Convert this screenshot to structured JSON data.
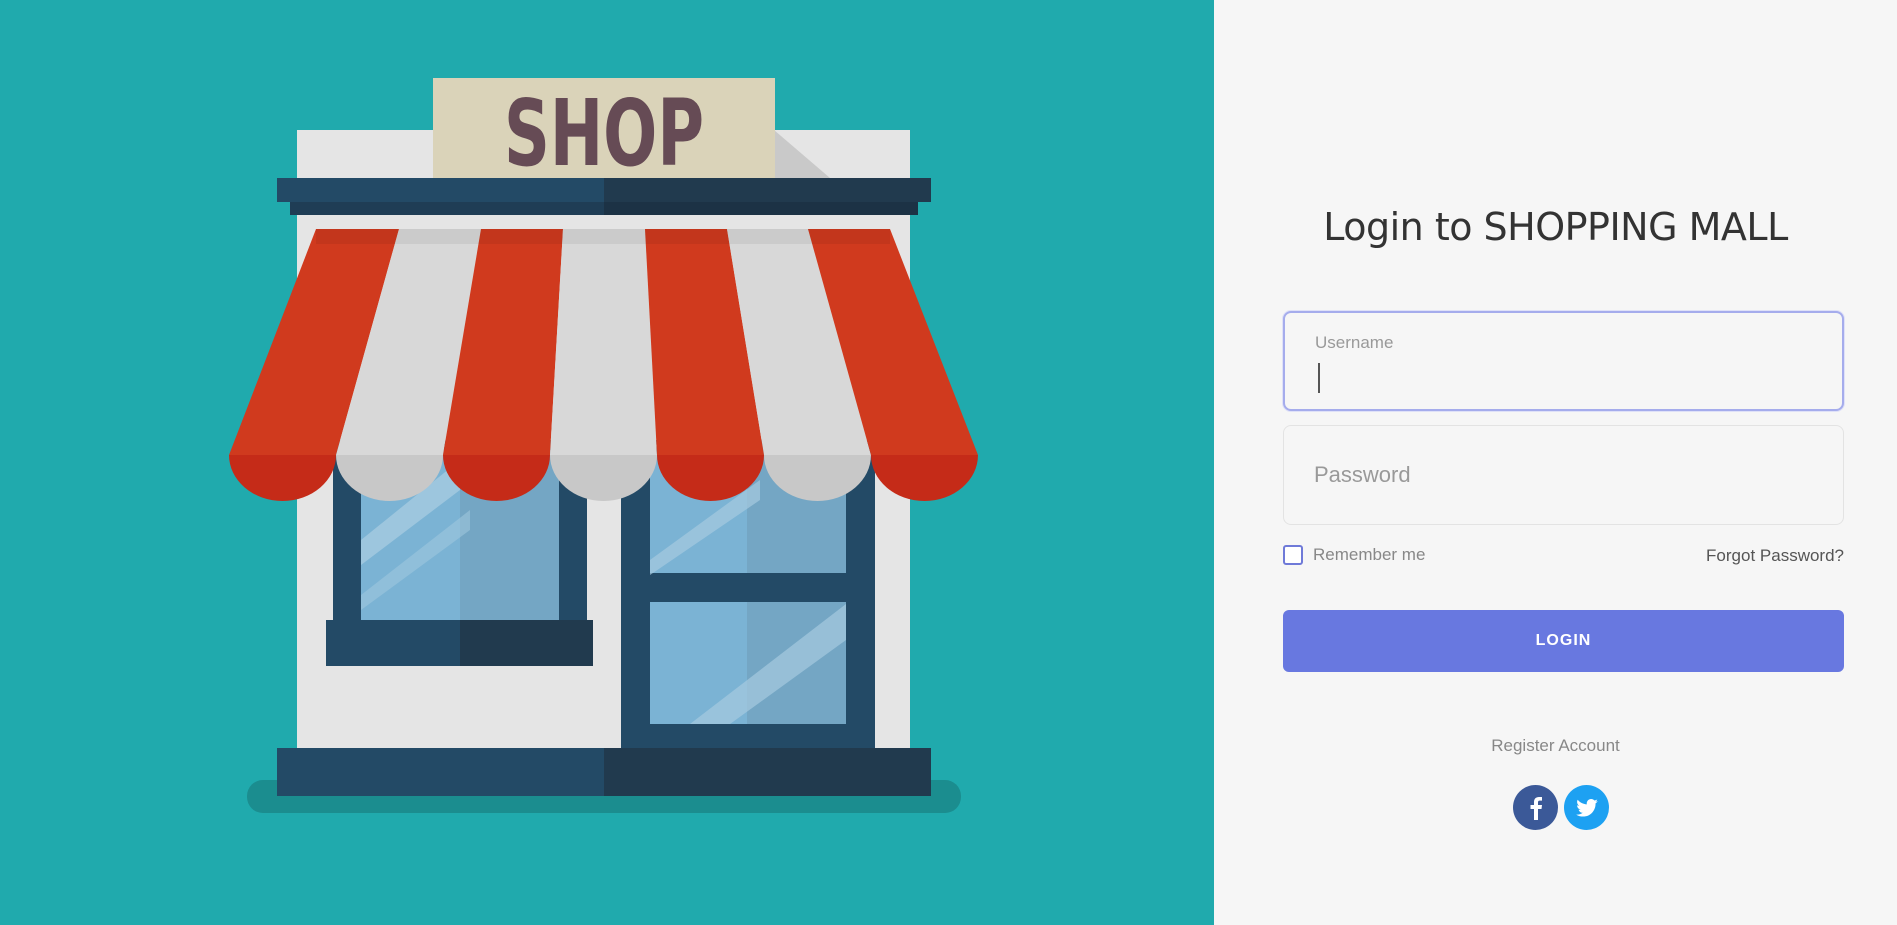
{
  "illustration": {
    "sign_text": "SHOP"
  },
  "login": {
    "title": "Login to SHOPPING MALL",
    "username": {
      "label": "Username",
      "value": ""
    },
    "password": {
      "placeholder": "Password"
    },
    "remember_label": "Remember me",
    "remember_checked": false,
    "forgot_label": "Forgot Password?",
    "login_button": "LOGIN",
    "register_label": "Register Account"
  },
  "social": {
    "items": [
      {
        "icon": "facebook-icon",
        "color": "#3b5998"
      },
      {
        "icon": "twitter-icon",
        "color": "#1da1f2"
      }
    ]
  },
  "colors": {
    "left_bg": "#20aaad",
    "accent": "#6878e0",
    "awning_red": "#d03a1e",
    "awning_white": "#d8d8d8"
  }
}
